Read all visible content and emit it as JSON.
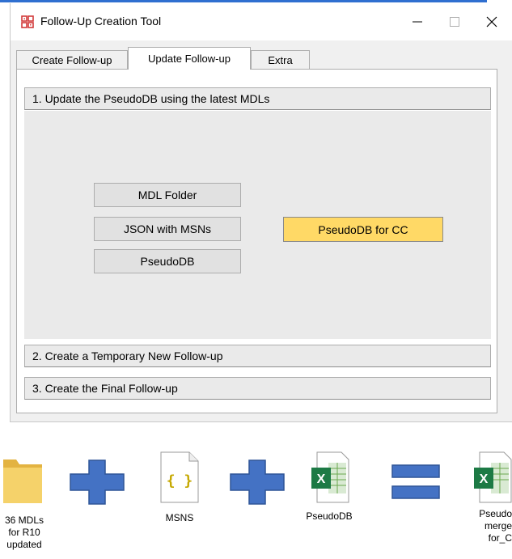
{
  "window": {
    "title": "Follow-Up Creation Tool",
    "controls": {
      "minimize": "—",
      "maximize": "☐",
      "close": "✕"
    }
  },
  "tabs": [
    {
      "label": "Create Follow-up"
    },
    {
      "label": "Update Follow-up"
    },
    {
      "label": "Extra"
    }
  ],
  "sections": {
    "s1": "1. Update the PseudoDB using the latest MDLs",
    "s2": "2. Create a Temporary New Follow-up",
    "s3": "3. Create the Final Follow-up"
  },
  "buttons": {
    "mdl_folder": "MDL Folder",
    "json_msns": "JSON with MSNs",
    "pseudodb": "PseudoDB",
    "pseudodb_cc": "PseudoDB for CC"
  },
  "diagram": {
    "folder_label": [
      "36 MDLs",
      "for R10",
      "updated"
    ],
    "json_glyph": "{ }",
    "json_label": "MSNS",
    "excel1_label": "PseudoDB",
    "excel_glyph": "X",
    "result_label": [
      "Pseudo",
      "merge",
      "for_C"
    ]
  },
  "colors": {
    "accent_button": "#ffd966",
    "plus_sign": "#4472c4",
    "folder": "#f0c75e",
    "excel": "#1d7a45",
    "json_brace": "#c5a800"
  }
}
